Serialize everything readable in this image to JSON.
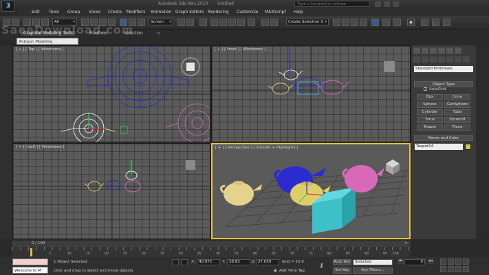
{
  "window": {
    "logo": "3",
    "app_title": "Autodesk 3ds Max 2010",
    "file_title": "Untitled",
    "search_placeholder": "Type a keyword or phrase"
  },
  "menu": [
    "Edit",
    "Tools",
    "Group",
    "Views",
    "Create",
    "Modifiers",
    "Animation",
    "Graph Editors",
    "Rendering",
    "Customize",
    "MAXScript",
    "Help"
  ],
  "toolbar": {
    "filter_value": "All",
    "ref_coord_value": "Screen",
    "selection_set_value": "Create Selection S"
  },
  "ribbon": {
    "tabs": [
      "Graphite Modeling Tools",
      "Freeform",
      "Selection"
    ],
    "active_tab": "Graphite Modeling Tools",
    "sub_panel": "Polygon Modeling"
  },
  "watermark": "SaeeDownload.com",
  "viewports": {
    "top": {
      "label": "[ + ] [ Top ] [ Wireframe ]"
    },
    "front": {
      "label": "[ + ] [ Front ] [ Wireframe ]"
    },
    "left": {
      "label": "[ + ] [ Left ] [ Wireframe ]"
    },
    "perspective": {
      "label": "[ + ] [ Perspective ] [ Smooth + Highlights ]"
    }
  },
  "command_panel": {
    "category_dropdown": "Standard Primitives",
    "object_type_header": "Object Type",
    "autogrid_label": "AutoGrid",
    "primitives": [
      "Box",
      "Cone",
      "Sphere",
      "GeoSphere",
      "Cylinder",
      "Tube",
      "Torus",
      "Pyramid",
      "Teapot",
      "Plane"
    ],
    "name_color_header": "Name and Color",
    "object_name": "Teapot04",
    "object_color": "#c8c85a"
  },
  "time": {
    "frame_counter": "0 / 100",
    "ticks": [
      "0",
      "5",
      "10",
      "15",
      "20",
      "25",
      "30",
      "35",
      "40",
      "45",
      "50",
      "55",
      "60",
      "65",
      "70",
      "75",
      "80",
      "85",
      "90",
      "95",
      "100"
    ]
  },
  "status": {
    "maxscript_listener": "Welcome to M",
    "selection_info": "1 Object Selected",
    "prompt": "Click and drag to select and move objects",
    "x_label": "X:",
    "x_value": "40.972",
    "y_label": "Y:",
    "y_value": "38.83",
    "z_label": "Z:",
    "z_value": "27.059",
    "grid": "Grid = 10.0",
    "add_time_tag": "Add Time Tag",
    "auto_key": "Auto Key",
    "set_key": "Set Key",
    "key_mode_value": "Selected",
    "key_filters": "Key Filters...",
    "current_frame": "0"
  },
  "colors": {
    "viewport_bg": "#5b5b5b",
    "active_border": "#e8c23a",
    "teapot_blue": "#2b2bd0",
    "teapot_yellow": "#dccf6b",
    "teapot_pink": "#d869b8",
    "teapot_cream": "#e5d38c",
    "box_teal": "#3fc1c9"
  }
}
